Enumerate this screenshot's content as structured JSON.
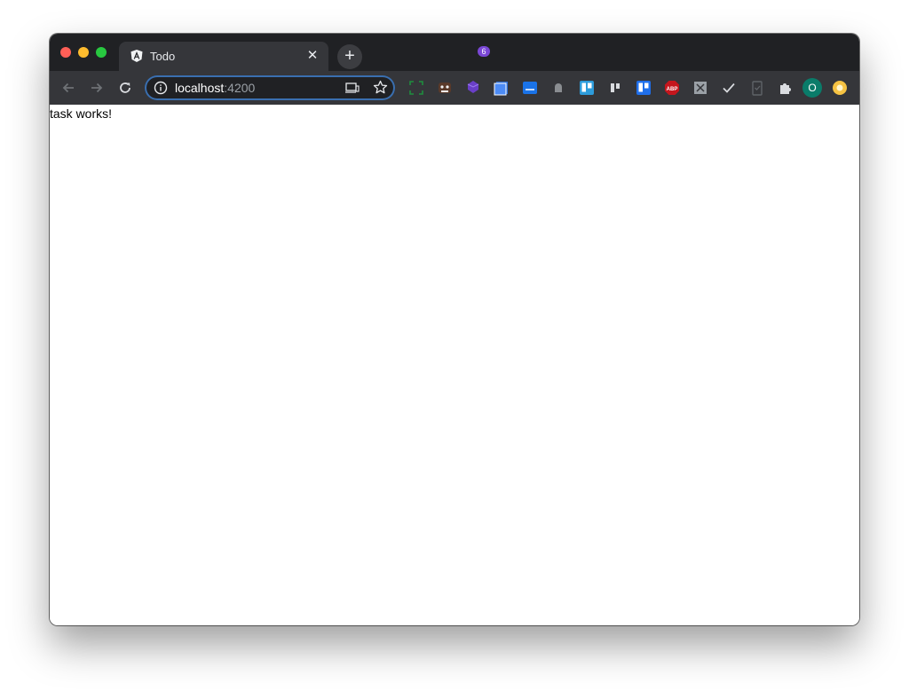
{
  "browser": {
    "tab": {
      "title": "Todo",
      "favicon": "angular-icon"
    },
    "address": {
      "host": "localhost",
      "port": ":4200"
    },
    "profile": {
      "initial": "O"
    },
    "extensions": {
      "badge_count": "6"
    }
  },
  "page": {
    "text": "task works!"
  },
  "colors": {
    "titlebar": "#202124",
    "toolbar": "#35363a",
    "omnibox_focus": "#3a6fb0"
  }
}
